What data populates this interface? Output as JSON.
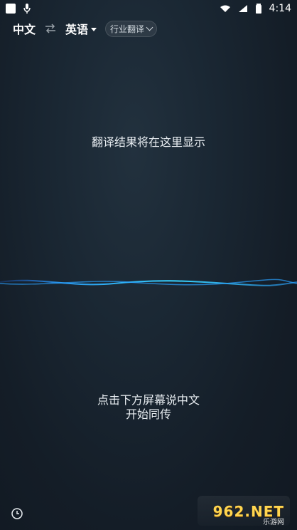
{
  "status_bar": {
    "time": "4:14"
  },
  "top_bar": {
    "source_lang": "中文",
    "target_lang": "英语",
    "industry_label": "行业翻译"
  },
  "main": {
    "result_placeholder": "翻译结果将在这里显示",
    "prompt_line1": "点击下方屏幕说中文",
    "prompt_line2": "开始同传"
  },
  "icons": {
    "swap": "swap-icon",
    "caret": "chevron-down-icon",
    "history": "history-icon",
    "mic": "mic-icon",
    "wifi": "wifi-icon",
    "cell": "cell-signal-icon",
    "battery": "battery-icon"
  },
  "watermark": {
    "brand": "962.NET",
    "sub": "乐游网"
  },
  "colors": {
    "bg_center": "#22313e",
    "bg_edge": "#111922",
    "wave_blue": "#2aa1ff",
    "wave_cyan": "#38d4ff"
  }
}
